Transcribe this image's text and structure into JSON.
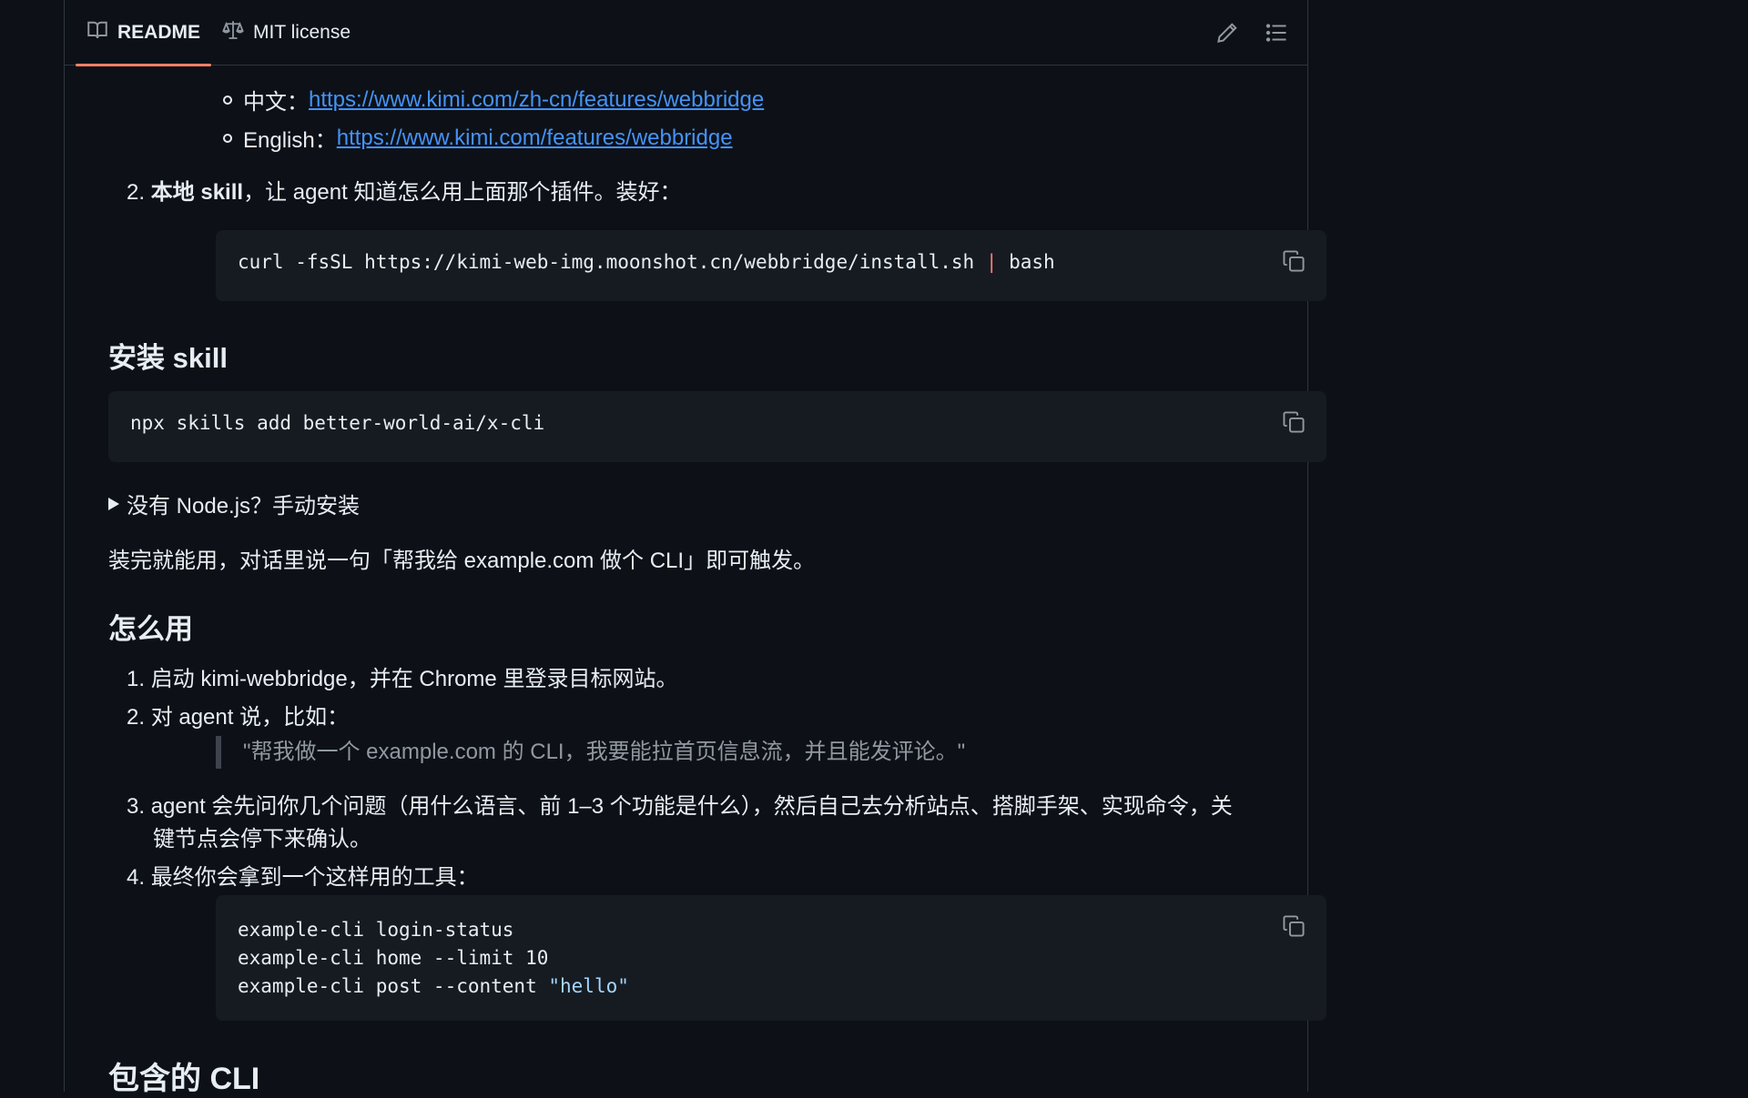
{
  "tabs": {
    "readme": "README",
    "license": "MIT license"
  },
  "links": [
    {
      "label": "中文：",
      "url": "https://www.kimi.com/zh-cn/features/webbridge"
    },
    {
      "label": "English：",
      "url": "https://www.kimi.com/features/webbridge"
    }
  ],
  "step2": {
    "num": "2.",
    "bold": "本地 skill",
    "rest": "，让 agent 知道怎么用上面那个插件。装好："
  },
  "code1": {
    "before": "curl -fsSL https://kimi-web-img.moonshot.cn/webbridge/install.sh ",
    "pipe": "|",
    "after": " bash"
  },
  "install_heading": "安装 skill",
  "code2": "npx skills add better-world-ai/x-cli",
  "details_summary": "没有 Node.js？手动安装",
  "trigger_text": "装完就能用，对话里说一句「帮我给 example.com 做个 CLI」即可触发。",
  "usage_heading": "怎么用",
  "usage_steps": [
    {
      "num": "1.",
      "text": "启动 kimi-webbridge，并在 Chrome 里登录目标网站。"
    },
    {
      "num": "2.",
      "text": "对 agent 说，比如："
    },
    {
      "num": "3.",
      "text": "agent 会先问你几个问题（用什么语言、前 1–3 个功能是什么），然后自己去分析站点、搭脚手架、实现命令，关"
    },
    {
      "num": "",
      "text": "键节点会停下来确认。"
    },
    {
      "num": "4.",
      "text": "最终你会拿到一个这样用的工具："
    }
  ],
  "quote": "\"帮我做一个 example.com 的 CLI，我要能拉首页信息流，并且能发评论。\"",
  "code3": {
    "line1": "example-cli login-status",
    "line2": "example-cli home --limit 10",
    "line3_cmd": "example-cli post --content ",
    "line3_str": "\"hello\""
  },
  "included_heading": "包含的 CLI",
  "colors": {
    "background": "#0d1117",
    "code_bg": "#161b22",
    "link": "#4493f8",
    "tab_underline": "#f78166"
  }
}
